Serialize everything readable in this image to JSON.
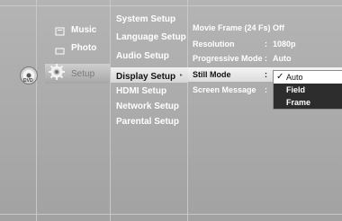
{
  "left_menu": {
    "music_label": "Music",
    "photo_label": "Photo",
    "setup_label": "Setup",
    "dvd_text": "DVD"
  },
  "setup_menu": {
    "items": [
      "System Setup",
      "Language Setup",
      "Audio Setup",
      "Display Setup",
      "HDMI Setup",
      "Network Setup",
      "Parental Setup"
    ],
    "selected_index": 3
  },
  "display_settings": [
    {
      "label": "Movie Frame (24 Fs)",
      "value": "Off"
    },
    {
      "label": "Resolution",
      "value": "1080p"
    },
    {
      "label": "Progressive Mode",
      "value": "Auto"
    },
    {
      "label": "Still Mode",
      "value": ""
    },
    {
      "label": "Screen Message",
      "value": ""
    }
  ],
  "separator": ":",
  "still_mode_options": [
    {
      "label": "Auto",
      "checked": true
    },
    {
      "label": "Field",
      "checked": false
    },
    {
      "label": "Frame",
      "checked": false
    }
  ],
  "icons": {
    "dvd": "dvd-disc-icon",
    "music": "music-note-icon",
    "photo": "photo-icon",
    "setup": "gear-icon",
    "check": "✓",
    "arrow": "▸"
  }
}
